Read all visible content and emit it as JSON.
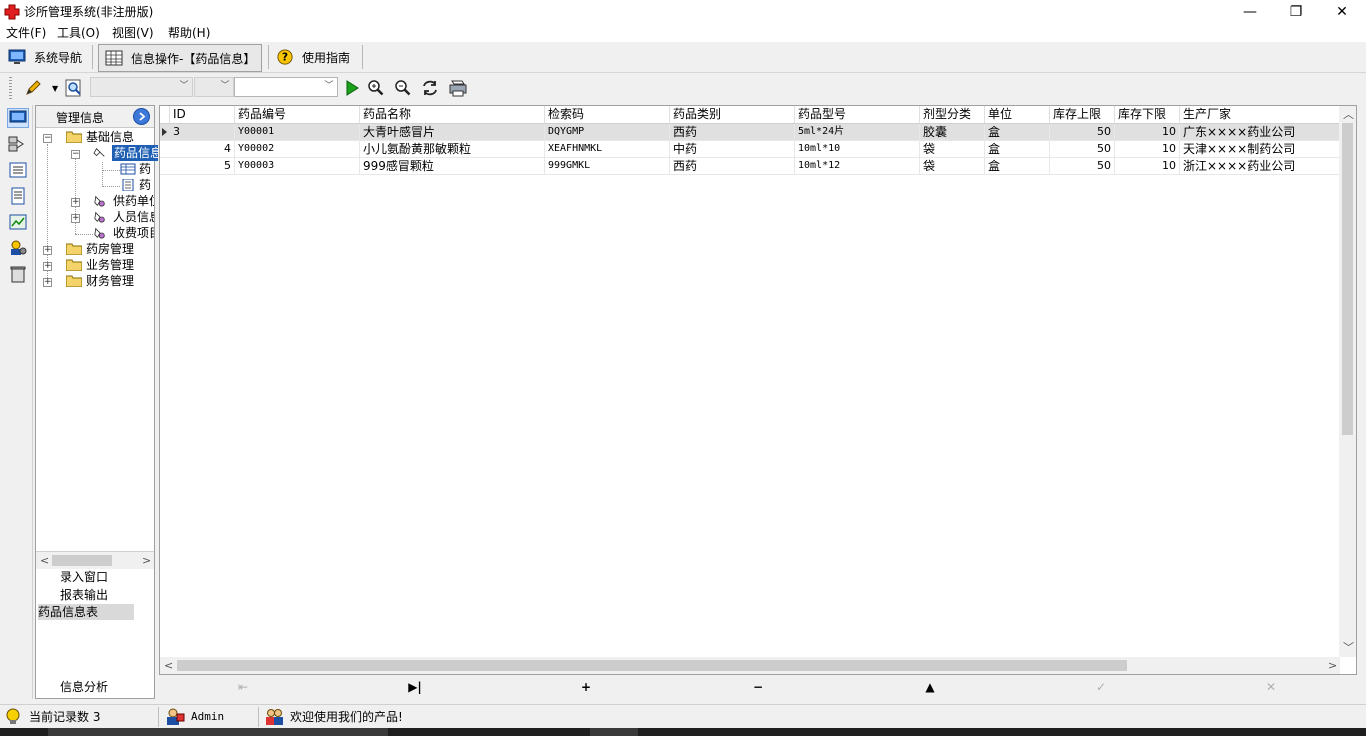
{
  "window": {
    "title": "诊所管理系统(非注册版)",
    "controls": {
      "minimize": "—",
      "maximize": "❐",
      "close": "✕"
    }
  },
  "menu": {
    "items": [
      "文件(F)",
      "工具(O)",
      "视图(V)",
      "帮助(H)"
    ]
  },
  "nav": {
    "system_nav": "系统导航",
    "info_tab": "信息操作-【药品信息】",
    "guide": "使用指南"
  },
  "tree": {
    "header": "管理信息",
    "nodes": {
      "basic": "基础信息",
      "drug_info": "药品信息",
      "drug_child1": "药",
      "drug_child2": "药",
      "supplier": "供药单位",
      "staff": "人员信息",
      "fees": "收费项目",
      "pharmacy": "药房管理",
      "business": "业务管理",
      "finance": "财务管理"
    }
  },
  "panel": {
    "entry_window": "录入窗口",
    "report_output": "报表输出",
    "drug_table": "药品信息表",
    "info_analysis": "信息分析"
  },
  "grid": {
    "columns": [
      "ID",
      "药品编号",
      "药品名称",
      "检索码",
      "药品类别",
      "药品型号",
      "剂型分类",
      "单位",
      "库存上限",
      "库存下限",
      "生产厂家"
    ],
    "rows": [
      {
        "id": "3",
        "code": "Y00001",
        "name": "大青叶感冒片",
        "search": "DQYGMP",
        "category": "西药",
        "model": "5ml*24片",
        "form": "胶囊",
        "unit": "盒",
        "max": "50",
        "min": "10",
        "maker": "广东××××药业公司"
      },
      {
        "id": "4",
        "code": "Y00002",
        "name": "小儿氨酚黄那敏颗粒",
        "search": "XEAFHNMKL",
        "category": "中药",
        "model": "10ml*10",
        "form": "袋",
        "unit": "盒",
        "max": "50",
        "min": "10",
        "maker": "天津××××制药公司"
      },
      {
        "id": "5",
        "code": "Y00003",
        "name": "999感冒颗粒",
        "search": "999GMKL",
        "category": "西药",
        "model": "10ml*12",
        "form": "袋",
        "unit": "盒",
        "max": "50",
        "min": "10",
        "maker": "浙江××××药业公司"
      }
    ]
  },
  "navigator": {
    "first": "⇤",
    "last": "▶|",
    "insert": "+",
    "delete": "−",
    "edit": "▲",
    "post": "✓",
    "cancel": "✕"
  },
  "status": {
    "record_count": "当前记录数 3",
    "user": "Admin",
    "welcome": "欢迎使用我们的产品!"
  }
}
